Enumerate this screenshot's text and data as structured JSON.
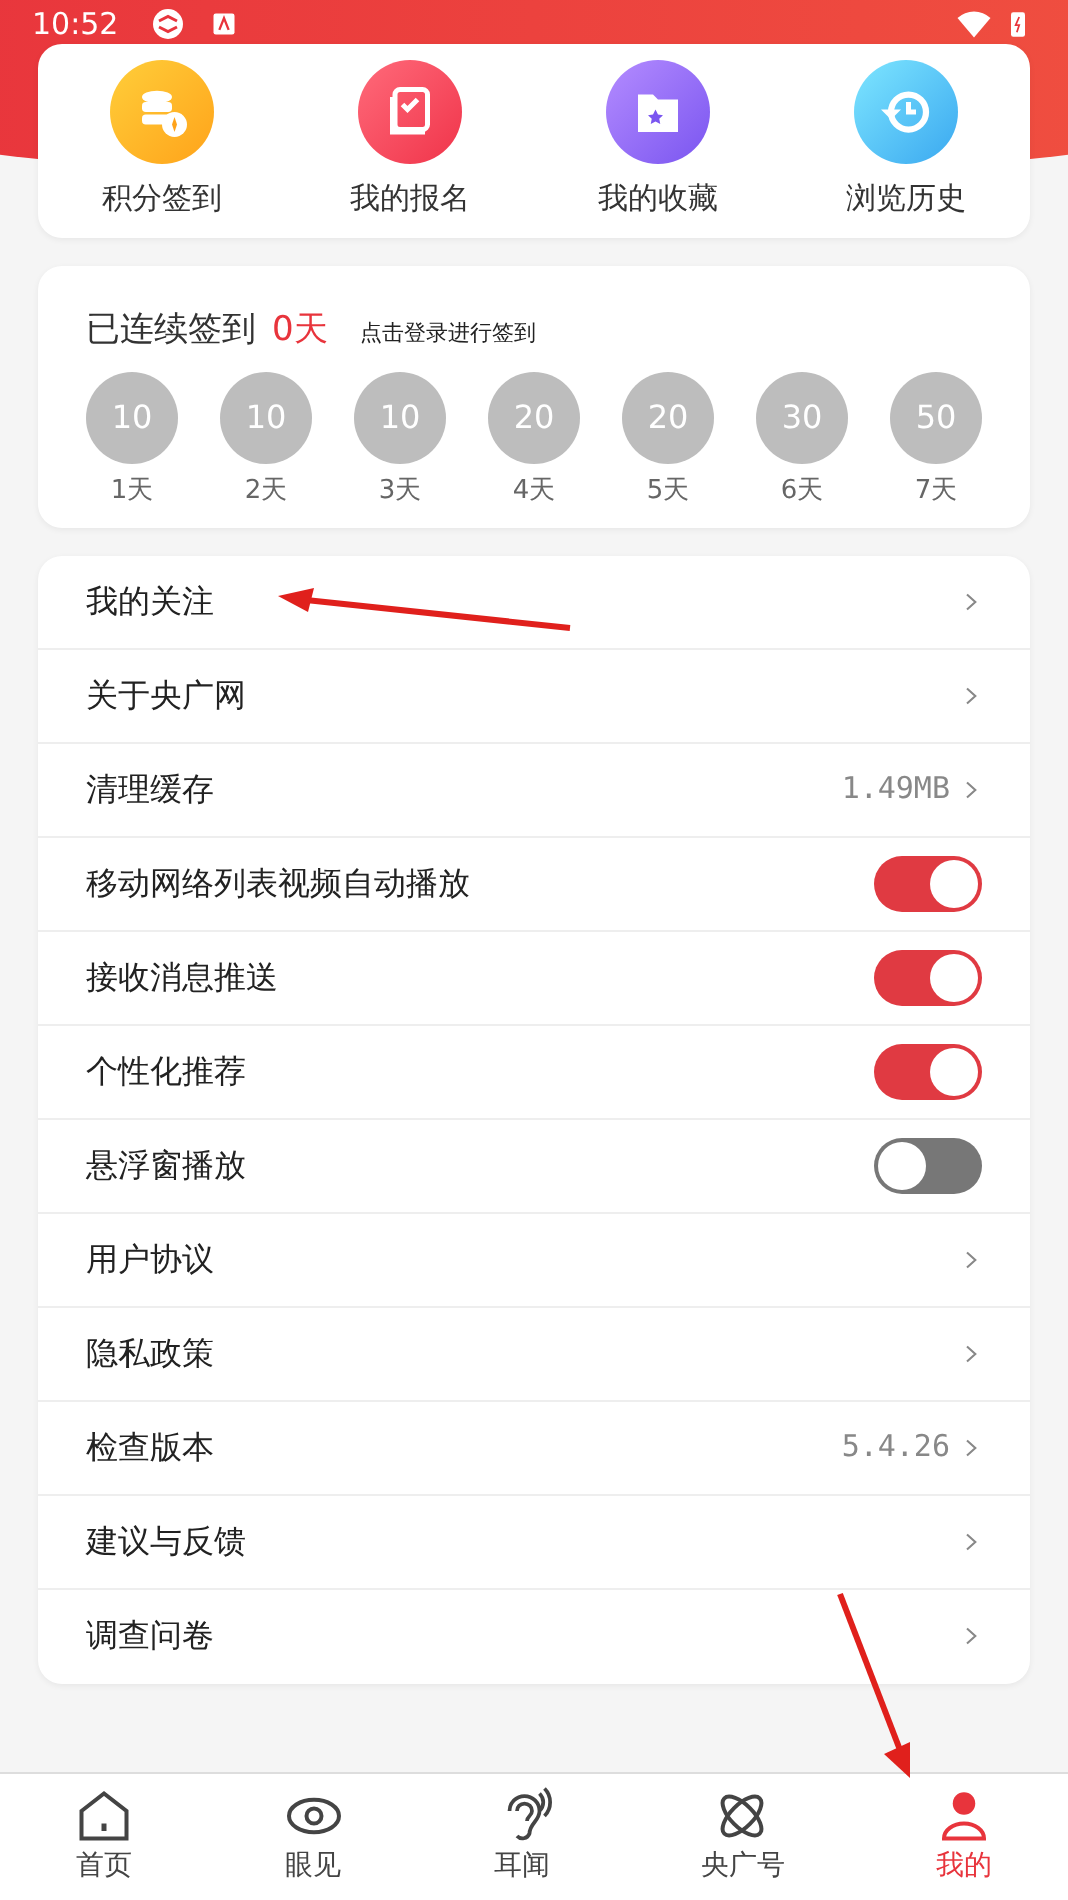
{
  "status_bar": {
    "time": "10:52"
  },
  "shortcuts": [
    {
      "label": "积分签到",
      "kind": "points"
    },
    {
      "label": "我的报名",
      "kind": "signup"
    },
    {
      "label": "我的收藏",
      "kind": "favorites"
    },
    {
      "label": "浏览历史",
      "kind": "history"
    }
  ],
  "checkin": {
    "title": "已连续签到",
    "count": "0天",
    "hint": "点击登录进行签到",
    "days": [
      {
        "points": "10",
        "day": "1天",
        "done": false
      },
      {
        "points": "10",
        "day": "2天",
        "done": false
      },
      {
        "points": "10",
        "day": "3天",
        "done": false
      },
      {
        "points": "20",
        "day": "4天",
        "done": false
      },
      {
        "points": "20",
        "day": "5天",
        "done": false
      },
      {
        "points": "30",
        "day": "6天",
        "done": false
      },
      {
        "points": "50",
        "day": "7天",
        "done": false
      }
    ]
  },
  "settings": [
    {
      "label": "我的关注",
      "kind": "link",
      "arrow_annotation": true
    },
    {
      "label": "关于央广网",
      "kind": "link"
    },
    {
      "label": "清理缓存",
      "kind": "link",
      "value": "1.49MB"
    },
    {
      "label": "移动网络列表视频自动播放",
      "kind": "toggle",
      "on": true
    },
    {
      "label": "接收消息推送",
      "kind": "toggle",
      "on": true
    },
    {
      "label": "个性化推荐",
      "kind": "toggle",
      "on": true
    },
    {
      "label": "悬浮窗播放",
      "kind": "toggle",
      "on": false
    },
    {
      "label": "用户协议",
      "kind": "link"
    },
    {
      "label": "隐私政策",
      "kind": "link"
    },
    {
      "label": "检查版本",
      "kind": "link",
      "value": "5.4.26"
    },
    {
      "label": "建议与反馈",
      "kind": "link"
    },
    {
      "label": "调查问卷",
      "kind": "link"
    }
  ],
  "tab_bar": [
    {
      "label": "首页",
      "kind": "home",
      "selected": false
    },
    {
      "label": "眼见",
      "kind": "eye",
      "selected": false
    },
    {
      "label": "耳闻",
      "kind": "ear",
      "selected": false
    },
    {
      "label": "央广号",
      "kind": "orbit",
      "selected": false
    },
    {
      "label": "我的",
      "kind": "person",
      "selected": true,
      "arrow_annotation": true
    }
  ]
}
